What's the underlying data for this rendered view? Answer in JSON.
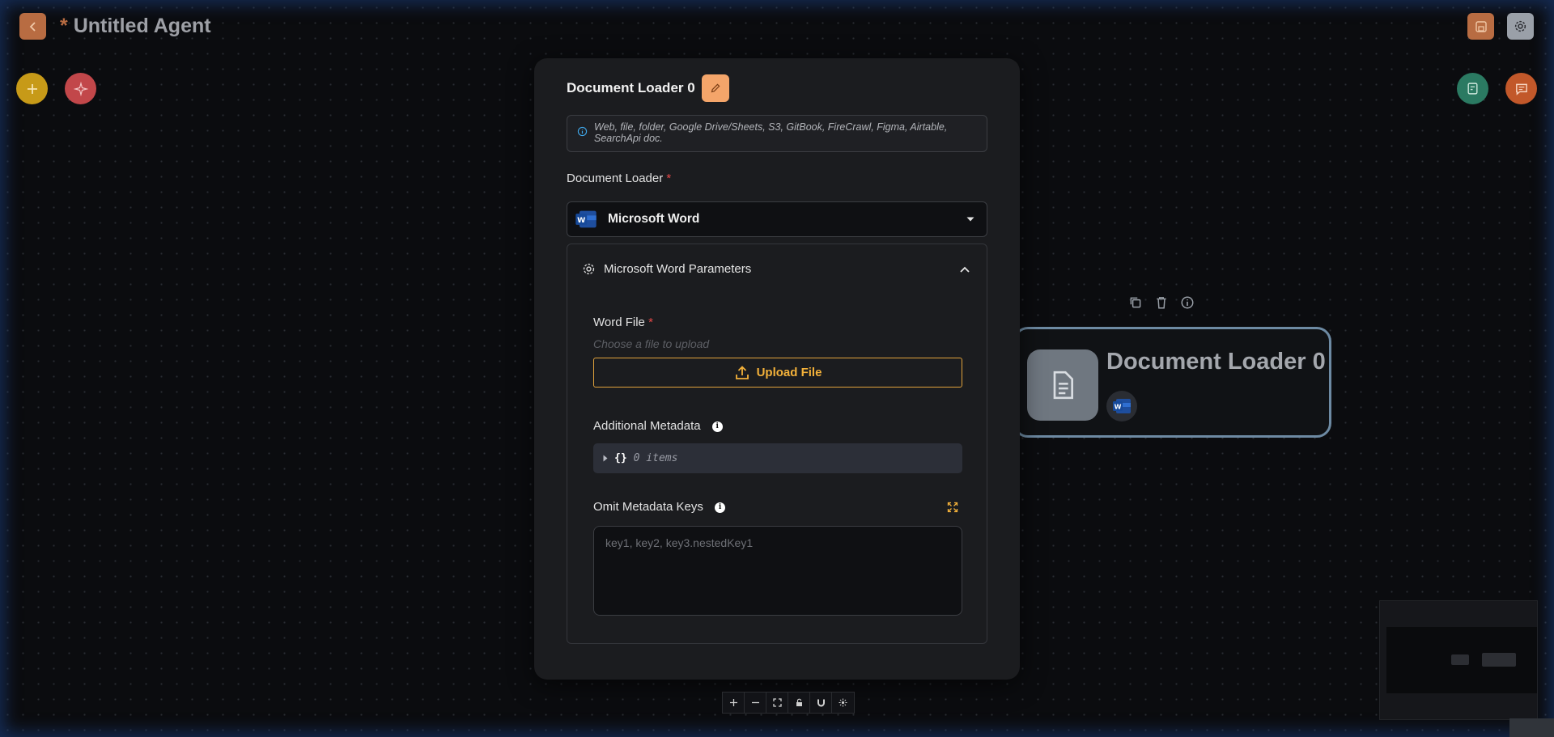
{
  "header": {
    "unsaved_marker": "*",
    "title": "Untitled Agent"
  },
  "modal": {
    "title": "Document Loader 0",
    "info_text": "Web, file, folder, Google Drive/Sheets, S3, GitBook, FireCrawl, Figma, Airtable, SearchApi doc.",
    "loader_label": "Document Loader",
    "required_marker": "*",
    "selected_loader": "Microsoft Word",
    "params_title": "Microsoft Word Parameters",
    "word_file_label": "Word File",
    "word_file_placeholder": "Choose a file to upload",
    "upload_label": "Upload File",
    "metadata_label": "Additional Metadata",
    "metadata_brace": "{}",
    "metadata_count": "0 items",
    "omit_label": "Omit Metadata Keys",
    "omit_placeholder": "key1, key2, key3.nestedKey1"
  },
  "node": {
    "title": "Document Loader 0"
  },
  "colors": {
    "accent": "#f4a56a",
    "upload": "#f3b13a",
    "node_border": "#6d8aa3",
    "required": "#e54848"
  },
  "icons": [
    "chevron-left-icon",
    "save-icon",
    "gear-icon",
    "plus-icon",
    "sparkle-icon",
    "checklist-icon",
    "chat-icon",
    "pencil-icon",
    "info-icon",
    "word-icon",
    "chevron-down-icon",
    "chevron-up-icon",
    "upload-icon",
    "expand-icon",
    "copy-icon",
    "trash-icon",
    "document-icon"
  ]
}
